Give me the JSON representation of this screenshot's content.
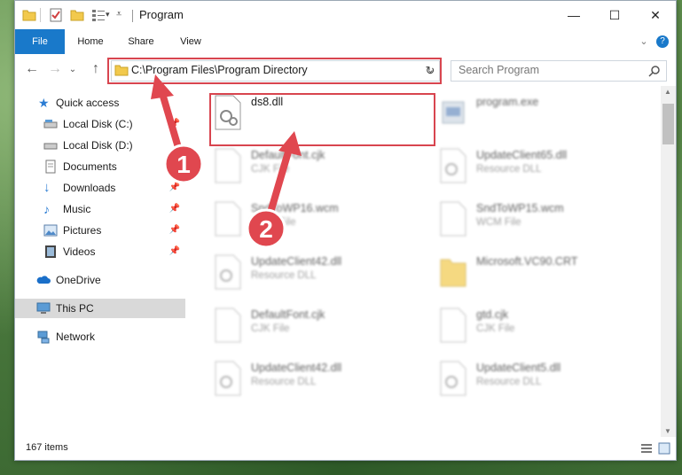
{
  "window": {
    "title": "Program",
    "minimize": "—",
    "maximize": "☐",
    "close": "✕",
    "help": "?",
    "ribbon_toggle": "⌄"
  },
  "ribbon": {
    "tabs": [
      {
        "label": "File"
      },
      {
        "label": "Home"
      },
      {
        "label": "Share"
      },
      {
        "label": "View"
      }
    ]
  },
  "nav": {
    "address": "C:\\Program Files\\Program Directory",
    "search_placeholder": "Search Program"
  },
  "sidebar": {
    "items": [
      {
        "label": "Quick access",
        "icon": "star-icon",
        "pinned": false
      },
      {
        "label": "Local Disk (C:)",
        "icon": "drive-icon",
        "pinned": true
      },
      {
        "label": "Local Disk (D:)",
        "icon": "drive-icon",
        "pinned": false
      },
      {
        "label": "Documents",
        "icon": "documents-icon",
        "pinned": true
      },
      {
        "label": "Downloads",
        "icon": "download-icon",
        "pinned": true
      },
      {
        "label": "Music",
        "icon": "music-icon",
        "pinned": true
      },
      {
        "label": "Pictures",
        "icon": "pictures-icon",
        "pinned": true
      },
      {
        "label": "Videos",
        "icon": "videos-icon",
        "pinned": true
      },
      {
        "label": "OneDrive",
        "icon": "cloud-icon",
        "pinned": false
      },
      {
        "label": "This PC",
        "icon": "pc-icon",
        "pinned": false,
        "selected": true
      },
      {
        "label": "Network",
        "icon": "network-icon",
        "pinned": false
      }
    ]
  },
  "files": [
    {
      "name": "ds8.dll",
      "type": "",
      "icon": "dll-gear-icon"
    },
    {
      "name": "program.exe",
      "type": "",
      "icon": "exe-icon"
    },
    {
      "name": "DefaultFont.cjk",
      "type": "CJK File",
      "icon": "file-icon"
    },
    {
      "name": "UpdateClient65.dll",
      "type": "Resource DLL",
      "icon": "dll-gear-icon"
    },
    {
      "name": "SndToWP16.wcm",
      "type": "WCM File",
      "icon": "file-icon"
    },
    {
      "name": "SndToWP15.wcm",
      "type": "WCM File",
      "icon": "file-icon"
    },
    {
      "name": "UpdateClient42.dll",
      "type": "Resource DLL",
      "icon": "dll-gear-icon"
    },
    {
      "name": "Microsoft.VC90.CRT",
      "type": "",
      "icon": "folder-icon"
    },
    {
      "name": "DefaultFont.cjk",
      "type": "CJK File",
      "icon": "file-icon"
    },
    {
      "name": "gtd.cjk",
      "type": "CJK File",
      "icon": "file-icon"
    },
    {
      "name": "UpdateClient42.dll",
      "type": "Resource DLL",
      "icon": "dll-gear-icon"
    },
    {
      "name": "UpdateClient5.dll",
      "type": "Resource DLL",
      "icon": "dll-gear-icon"
    }
  ],
  "status": {
    "item_count": "167 items"
  },
  "annotations": {
    "step1": "1",
    "step2": "2"
  },
  "colors": {
    "accent": "#1979ca",
    "highlight": "#d8454f",
    "arrow": "#e0474f"
  }
}
